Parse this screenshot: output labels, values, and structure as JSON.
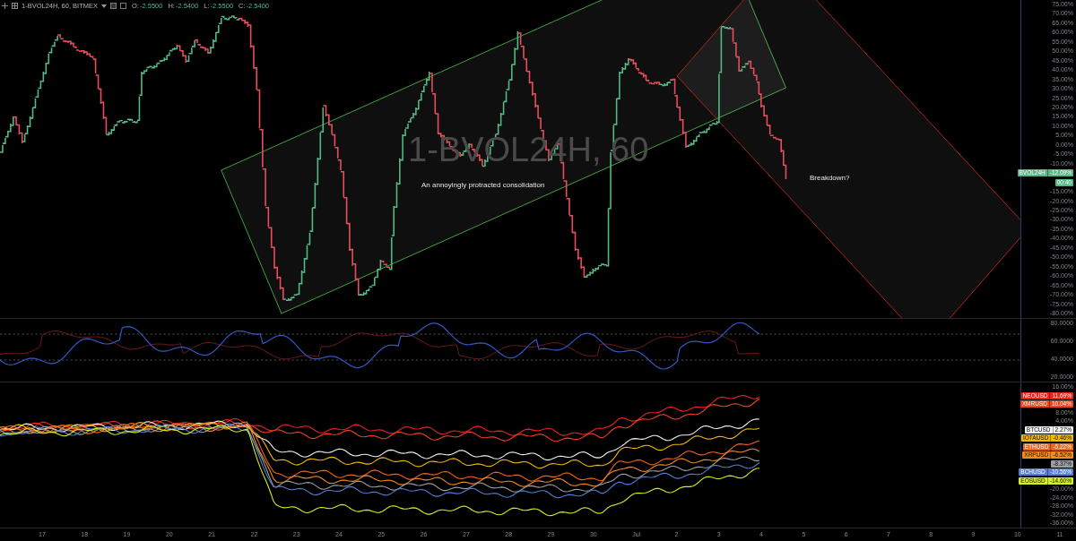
{
  "header": {
    "symbol": "1-BVOL24H, 60, BITMEX",
    "ohlc": [
      {
        "label": "O:",
        "value": "-2.5500"
      },
      {
        "label": "H:",
        "value": "-2.5400"
      },
      {
        "label": "L:",
        "value": "-2.5500"
      },
      {
        "label": "C:",
        "value": "-2.5400"
      }
    ]
  },
  "watermark": {
    "line_1": "1-BVOL24H, 60"
  },
  "annotations": [
    {
      "text": "An annoyingly protracted consolidation"
    },
    {
      "text": "Breakdown?"
    }
  ],
  "price_axis": {
    "items": [
      {
        "kind": "label",
        "text": "75.00%"
      },
      {
        "kind": "label",
        "text": "70.00%"
      },
      {
        "kind": "label",
        "text": "65.00%"
      },
      {
        "kind": "label",
        "text": "60.00%"
      },
      {
        "kind": "label",
        "text": "55.00%"
      },
      {
        "kind": "label",
        "text": "50.00%"
      },
      {
        "kind": "label",
        "text": "45.00%"
      },
      {
        "kind": "label",
        "text": "40.00%"
      },
      {
        "kind": "label",
        "text": "35.00%"
      },
      {
        "kind": "label",
        "text": "30.00%"
      },
      {
        "kind": "label",
        "text": "25.00%"
      },
      {
        "kind": "label",
        "text": "20.00%"
      },
      {
        "kind": "label",
        "text": "15.00%"
      },
      {
        "kind": "label",
        "text": "10.00%"
      },
      {
        "kind": "label",
        "text": "5.00%"
      },
      {
        "kind": "label",
        "text": "0.00%"
      },
      {
        "kind": "label",
        "text": "-5.00%"
      },
      {
        "kind": "label",
        "text": "-10.00%"
      },
      {
        "kind": "badge",
        "symbol": "BVOL24H",
        "text": "-12.09%",
        "color": "#53b987"
      },
      {
        "kind": "countdown",
        "text": "00:40",
        "color": "#53b987"
      },
      {
        "kind": "label",
        "text": "-15.00%"
      },
      {
        "kind": "label",
        "text": "-20.00%"
      },
      {
        "kind": "label",
        "text": "-25.00%"
      },
      {
        "kind": "label",
        "text": "-30.00%"
      },
      {
        "kind": "label",
        "text": "-35.00%"
      },
      {
        "kind": "label",
        "text": "-40.00%"
      },
      {
        "kind": "label",
        "text": "-45.00%"
      },
      {
        "kind": "label",
        "text": "-50.00%"
      },
      {
        "kind": "label",
        "text": "-55.00%"
      },
      {
        "kind": "label",
        "text": "-60.00%"
      },
      {
        "kind": "label",
        "text": "-65.00%"
      },
      {
        "kind": "label",
        "text": "-70.00%"
      },
      {
        "kind": "label",
        "text": "-75.00%"
      },
      {
        "kind": "label",
        "text": "-80.00%"
      }
    ]
  },
  "oscillator_axis": {
    "labels": [
      "80.0000",
      "60.0000",
      "40.0000",
      "20.0000"
    ]
  },
  "comparison_axis": {
    "items": [
      {
        "kind": "label",
        "text": "16.00%"
      },
      {
        "kind": "badge",
        "symbol": "NEOUSD",
        "text": "11.69%",
        "color": "#e8231e"
      },
      {
        "kind": "badge",
        "symbol": "XMRUSD",
        "text": "10.04%",
        "color": "#f2401c"
      },
      {
        "kind": "label",
        "text": "8.00%"
      },
      {
        "kind": "label",
        "text": "4.00%"
      },
      {
        "kind": "badge",
        "symbol": "BTCUSD",
        "text": "2.27%",
        "color": "#f4f4f4"
      },
      {
        "kind": "badge",
        "symbol": "IOTAUSD",
        "text": "-0.46%",
        "color": "#f2b705"
      },
      {
        "kind": "badge",
        "symbol": "ETHUSD",
        "text": "-5.22%",
        "color": "#f0641e"
      },
      {
        "kind": "badge",
        "symbol": "XRPUSD",
        "text": "-6.52%",
        "color": "#f28c1e"
      },
      {
        "kind": "badge",
        "text": "-8.37%",
        "color": "#9a9ea6"
      },
      {
        "kind": "badge",
        "symbol": "BCHUSD",
        "text": "-10.56%",
        "color": "#4f7fd6"
      },
      {
        "kind": "badge",
        "symbol": "EOSUSD",
        "text": "-14.60%",
        "color": "#d4f01e"
      },
      {
        "kind": "label",
        "text": "-20.00%"
      },
      {
        "kind": "label",
        "text": "-24.00%"
      },
      {
        "kind": "label",
        "text": "-28.00%"
      },
      {
        "kind": "label",
        "text": "-32.00%"
      },
      {
        "kind": "label",
        "text": "-36.00%"
      }
    ]
  },
  "time_axis": {
    "labels": [
      "17",
      "18",
      "19",
      "20",
      "21",
      "22",
      "23",
      "24",
      "25",
      "26",
      "27",
      "28",
      "29",
      "30",
      "Jul",
      "2",
      "3",
      "4",
      "5",
      "6",
      "7",
      "8",
      "9",
      "10",
      "11"
    ]
  }
}
